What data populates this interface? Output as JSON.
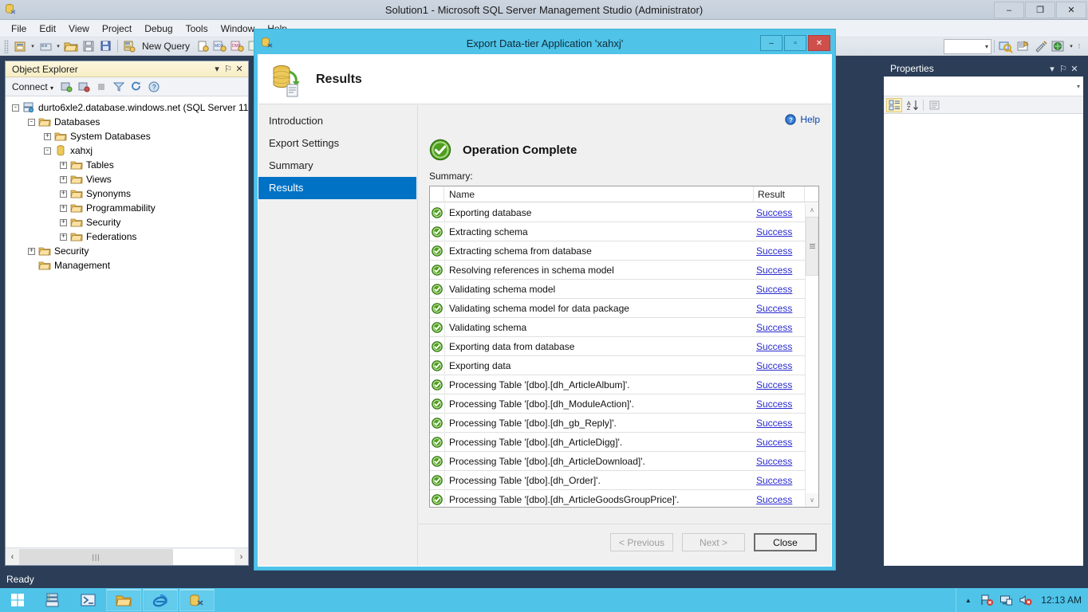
{
  "window": {
    "title": "Solution1 - Microsoft SQL Server Management Studio (Administrator)",
    "minimize": "–",
    "maximize": "❐",
    "close": "✕",
    "status": "Ready"
  },
  "menubar": {
    "items": [
      "File",
      "Edit",
      "View",
      "Project",
      "Debug",
      "Tools",
      "Window",
      "Help"
    ]
  },
  "toolbar": {
    "new_query_label": "New Query"
  },
  "object_explorer": {
    "title": "Object Explorer",
    "connect_label": "Connect",
    "dropdown": "▾",
    "pin": "⚐",
    "close": "✕",
    "tree": [
      {
        "label": "durto6xle2.database.windows.net (SQL Server 11.",
        "indent": 0,
        "expander": "-",
        "icon": "server-icon"
      },
      {
        "label": "Databases",
        "indent": 1,
        "expander": "-",
        "icon": "folder-icon"
      },
      {
        "label": "System Databases",
        "indent": 2,
        "expander": "+",
        "icon": "folder-icon"
      },
      {
        "label": "xahxj",
        "indent": 2,
        "expander": "-",
        "icon": "database-icon"
      },
      {
        "label": "Tables",
        "indent": 3,
        "expander": "+",
        "icon": "folder-icon"
      },
      {
        "label": "Views",
        "indent": 3,
        "expander": "+",
        "icon": "folder-icon"
      },
      {
        "label": "Synonyms",
        "indent": 3,
        "expander": "+",
        "icon": "folder-icon"
      },
      {
        "label": "Programmability",
        "indent": 3,
        "expander": "+",
        "icon": "folder-icon"
      },
      {
        "label": "Security",
        "indent": 3,
        "expander": "+",
        "icon": "folder-icon"
      },
      {
        "label": "Federations",
        "indent": 3,
        "expander": "+",
        "icon": "folder-icon"
      },
      {
        "label": "Security",
        "indent": 1,
        "expander": "+",
        "icon": "folder-icon"
      },
      {
        "label": "Management",
        "indent": 1,
        "expander": "",
        "icon": "folder-icon"
      }
    ],
    "hscroll_left": "‹",
    "hscroll_right": "›",
    "hscroll_grip": "|||"
  },
  "properties": {
    "title": "Properties",
    "dropdown": "▾",
    "pin": "⚐",
    "close": "✕",
    "combo_arrow": "▾"
  },
  "dialog": {
    "title": "Export Data-tier Application 'xahxj'",
    "minimize": "–",
    "maximize": "▫",
    "close": "✕",
    "header_title": "Results",
    "nav": [
      {
        "label": "Introduction",
        "active": false
      },
      {
        "label": "Export Settings",
        "active": false
      },
      {
        "label": "Summary",
        "active": false
      },
      {
        "label": "Results",
        "active": true
      }
    ],
    "help_label": "Help",
    "operation_status": "Operation Complete",
    "summary_label": "Summary:",
    "table": {
      "columns": [
        "Name",
        "Result"
      ],
      "rows": [
        {
          "name": "Exporting database",
          "result": "Success"
        },
        {
          "name": "Extracting schema",
          "result": "Success"
        },
        {
          "name": "Extracting schema from database",
          "result": "Success"
        },
        {
          "name": "Resolving references in schema model",
          "result": "Success"
        },
        {
          "name": "Validating schema model",
          "result": "Success"
        },
        {
          "name": "Validating schema model for data package",
          "result": "Success"
        },
        {
          "name": "Validating schema",
          "result": "Success"
        },
        {
          "name": "Exporting data from database",
          "result": "Success"
        },
        {
          "name": "Exporting data",
          "result": "Success"
        },
        {
          "name": "Processing Table '[dbo].[dh_ArticleAlbum]'.",
          "result": "Success"
        },
        {
          "name": "Processing Table '[dbo].[dh_ModuleAction]'.",
          "result": "Success"
        },
        {
          "name": "Processing Table '[dbo].[dh_gb_Reply]'.",
          "result": "Success"
        },
        {
          "name": "Processing Table '[dbo].[dh_ArticleDigg]'.",
          "result": "Success"
        },
        {
          "name": "Processing Table '[dbo].[dh_ArticleDownload]'.",
          "result": "Success"
        },
        {
          "name": "Processing Table '[dbo].[dh_Order]'.",
          "result": "Success"
        },
        {
          "name": "Processing Table '[dbo].[dh_ArticleGoodsGroupPrice]'.",
          "result": "Success"
        }
      ]
    },
    "scroll_up": "∧",
    "scroll_down": "∨",
    "buttons": {
      "previous": "< Previous",
      "next": "Next >",
      "close": "Close"
    }
  },
  "taskbar": {
    "clock": "12:13 AM",
    "tray_expand": "▲"
  },
  "colors": {
    "accent_cyan": "#4fc3e8",
    "nav_selected": "#0072c6",
    "link": "#2a2ad0",
    "success_green": "#4caf1e",
    "window_bg": "#2b3d57"
  }
}
